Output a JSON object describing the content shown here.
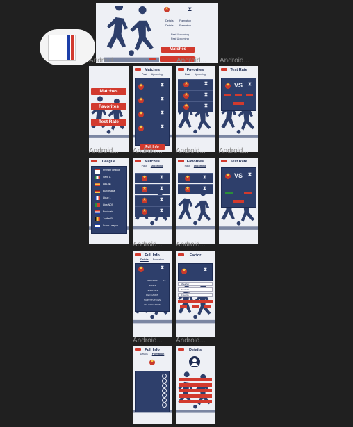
{
  "colors": {
    "canvas": "#202020",
    "screen": "#eef0f5",
    "navy": "#1d2b52",
    "panel": "#2e3f6b",
    "red": "#d23a2e",
    "gold": "#f7c948",
    "label": "#8a8a8a"
  },
  "frame_label": "Android...",
  "logo": {
    "name": "app-logo-icon"
  },
  "splash": {
    "tab_details": "Details",
    "tab_formation": "Formation",
    "past_upcoming": "Past Upcoming",
    "title": "Matches"
  },
  "menu": {
    "matches": "Matches",
    "favorites": "Favorites",
    "test_rate": "Test Rate"
  },
  "screens": {
    "matches": "Matches",
    "favorites": "Favorites",
    "test_rate": "Test Rate",
    "league": "League",
    "full_info": "Full Info",
    "factor": "Factor",
    "details": "Details"
  },
  "tabs": {
    "past": "Past",
    "upcoming": "Upcoming",
    "details": "Details",
    "formation": "Formation"
  },
  "vs": "VS",
  "full_info_button": "Full Info",
  "leagues": [
    "Premier League",
    "Serie A",
    "La Liga",
    "Bundesliga",
    "Ligue 1",
    "Liga NOS",
    "Eredivisie",
    "Jupiler PL",
    "Super League"
  ],
  "stats": [
    "ATTEMPTS",
    "GOALS",
    "PENALTIES",
    "RED CARDS",
    "SUBSTITUTIONS",
    "YELLOW CARDS"
  ],
  "stat_value": "13",
  "factor_options": [
    "Weather",
    "Football",
    "Favorite"
  ]
}
